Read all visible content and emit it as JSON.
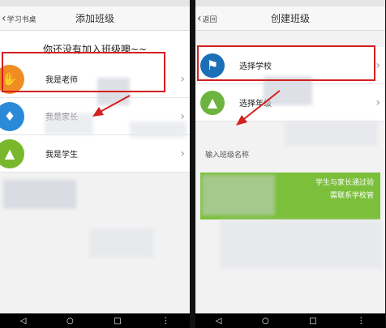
{
  "left": {
    "back_label": "学习书桌",
    "title": "添加班级",
    "heading": "你还没有加入班级噢~~",
    "rows": [
      {
        "label": "我是老师"
      },
      {
        "label": "我是家长"
      },
      {
        "label": "我是学生"
      }
    ]
  },
  "right": {
    "back_label": "返回",
    "title": "创建班级",
    "rows": [
      {
        "label": "选择学校"
      },
      {
        "label": "选择年级"
      }
    ],
    "input_label": "输入班级名称",
    "notice_line1": "学生与家长通过验",
    "notice_line2": "需联系学校管"
  },
  "nav": {
    "back": "◁",
    "home": "○",
    "recent": "□",
    "more": "⋮"
  },
  "colors": {
    "highlight": "#d32020",
    "green": "#7bbf3b"
  }
}
